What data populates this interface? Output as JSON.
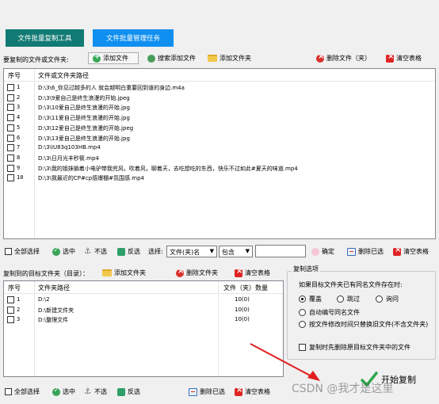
{
  "tabs": [
    {
      "label": "文件批量复制工具",
      "color": "#127a74"
    },
    {
      "label": "文件批量管理任务",
      "color": "#0f8ff0"
    }
  ],
  "source": {
    "label": "要复制的文件或文件夹:",
    "add_file": "添加文件",
    "search_add_file": "搜索添加文件",
    "add_folder": "添加文件夹",
    "delete_file": "删除文件（夹）",
    "clear_table": "清空表格",
    "columns": [
      "序号",
      "文件或文件夹路径"
    ],
    "rows": [
      {
        "num": "1",
        "path": "D:\\3\\6_你见过越多的人 就会越明白重要回到谁的身边.m4a"
      },
      {
        "num": "2",
        "path": "D:\\3\\9爱自己是终生浪漫的开始.jpeg"
      },
      {
        "num": "3",
        "path": "D:\\3\\10爱自己是终生浪漫的开始.jpg"
      },
      {
        "num": "4",
        "path": "D:\\3\\11爱自己是终生浪漫的开始.jpg"
      },
      {
        "num": "5",
        "path": "D:\\3\\12爱自己是终生浪漫的开始.jpeg"
      },
      {
        "num": "6",
        "path": "D:\\3\\13爱自己是终生浪漫的开始.jpg"
      },
      {
        "num": "7",
        "path": "D:\\3\\IU83q103HB.mp4"
      },
      {
        "num": "8",
        "path": "D:\\3\\日月光丰秒筱.mp4"
      },
      {
        "num": "9",
        "path": "D:\\3\\我的姐妹躺着小电驴带我兜风，吹着风，聊着天，去吃想吃的东西，快乐不过如此#夏天的味道.mp4"
      },
      {
        "num": "10",
        "path": "D:\\3\\我最近的CP#cp感爆棚#氛围感.mp4"
      }
    ],
    "select_all": "全部选择",
    "select": "选中",
    "unselect": "不选",
    "invert": "反选",
    "choose_label": "选择:",
    "filter_field": "文件(夹)名",
    "filter_op": "包含",
    "filter_value": "",
    "confirm": "确定",
    "delete_selected": "删除已选",
    "clear_table2": "清空表格"
  },
  "target": {
    "label": "复制到的目标文件夹（目录）：",
    "add_folder": "添加文件夹",
    "delete_folder": "删除文件夹",
    "clear_table": "清空表格",
    "columns": [
      "序号",
      "文件夹路径",
      "文件（夹）数量"
    ],
    "rows": [
      {
        "num": "1",
        "path": "D:\\2",
        "count": "10(0)"
      },
      {
        "num": "2",
        "path": "D:\\新建文件夹",
        "count": "10(0)"
      },
      {
        "num": "3",
        "path": "D:\\整理文件",
        "count": "10(0)"
      }
    ],
    "select_all": "全部选择",
    "select": "选中",
    "unselect": "不选",
    "invert": "反选",
    "delete_selected": "删除已选",
    "clear_table2": "清空表格"
  },
  "options": {
    "title": "复制选项",
    "exists_label": "如果目标文件夹已有同名文件存在时:",
    "overwrite": "覆盖",
    "skip": "跳过",
    "ask": "询问",
    "auto_rename": "自动编号同名文件",
    "replace_by_time": "按文件修改时间只替换旧文件(不含文件夹)",
    "delete_before_copy": "复制时先删除原目标文件夹中的文件",
    "start_button": "开始复制"
  },
  "watermark": "CSDN @我才是这里"
}
